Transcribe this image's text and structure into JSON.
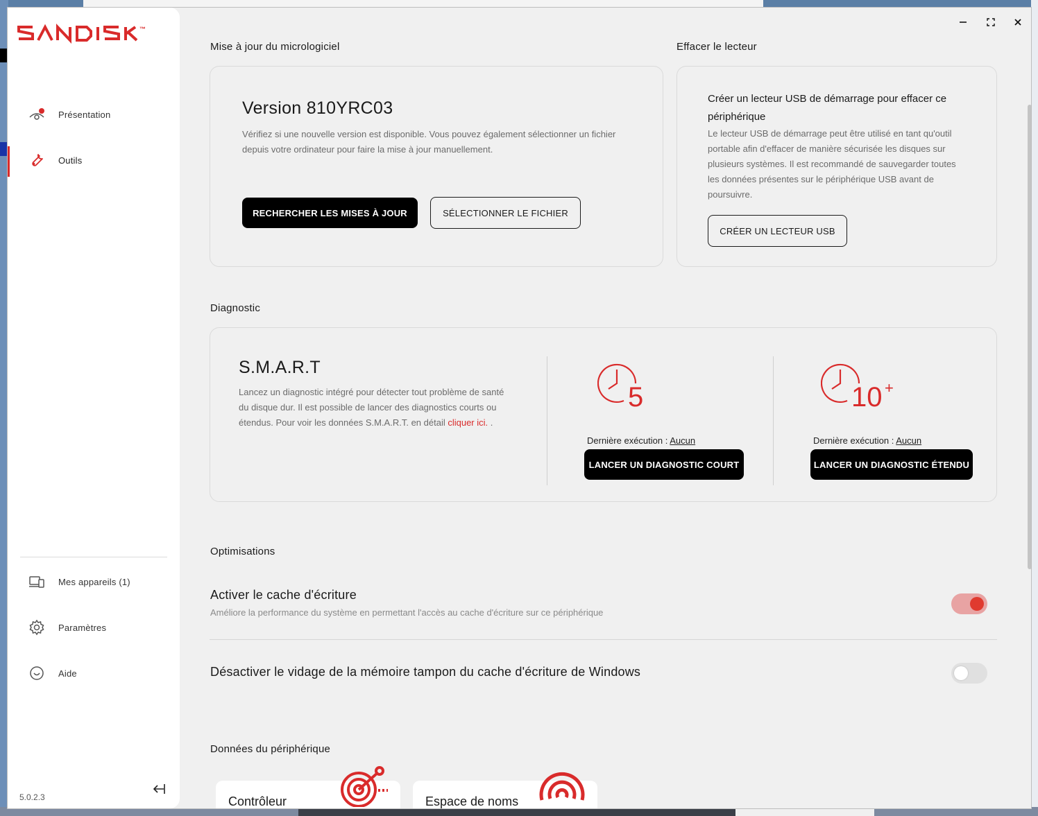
{
  "app": {
    "brand": "SANDISK",
    "trademark": "™",
    "version": "5.0.2.3",
    "accent_color": "#d92b2b"
  },
  "window_controls": {
    "minimize_icon": "minimize-icon",
    "maximize_icon": "maximize-icon",
    "close_icon": "close-icon"
  },
  "sidebar": {
    "items": [
      {
        "label": "Présentation",
        "icon": "eye-with-dot-icon"
      },
      {
        "label": "Outils",
        "icon": "wrench-icon",
        "active": true
      }
    ],
    "bottom_items": [
      {
        "label": "Mes appareils (1)",
        "icon": "devices-icon"
      },
      {
        "label": "Paramètres",
        "icon": "gear-icon"
      },
      {
        "label": "Aide",
        "icon": "help-icon"
      }
    ]
  },
  "firmware": {
    "section_title": "Mise à jour du micrologiciel",
    "version": "Version 810YRC03",
    "description": "Vérifiez si une nouvelle version est disponible. Vous pouvez également sélectionner un fichier depuis votre ordinateur pour faire la mise à jour manuellement.",
    "check_button": "RECHERCHER LES MISES À JOUR",
    "select_file_button": "SÉLECTIONNER LE FICHIER"
  },
  "erase": {
    "section_title": "Effacer le lecteur",
    "title": "Créer un lecteur USB de démarrage pour effacer ce périphérique",
    "description": "Le lecteur USB de démarrage peut être utilisé en tant qu'outil portable afin d'effacer de manière sécurisée les disques sur plusieurs systèmes. Il est recommandé de sauvegarder toutes les données présentes sur le périphérique USB avant de poursuivre.",
    "create_button": "CRÉER UN LECTEUR USB"
  },
  "diagnostic": {
    "section_title": "Diagnostic",
    "title": "S.M.A.R.T",
    "description": "Lancez un diagnostic intégré pour détecter tout problème de santé du disque dur. Il est possible de lancer des diagnostics courts ou étendus. Pour voir les données S.M.A.R.T. en détail",
    "link_text": "cliquer ici.",
    "link_suffix": " .",
    "short": {
      "icon_number": "5",
      "last_run_label": "Dernière exécution : ",
      "last_run_value": "Aucun",
      "button": "LANCER UN DIAGNOSTIC COURT"
    },
    "extended": {
      "icon_number": "10",
      "icon_plus": "+",
      "last_run_label": "Dernière exécution : ",
      "last_run_value": "Aucun",
      "button": "LANCER UN DIAGNOSTIC ÉTENDU"
    }
  },
  "optimisations": {
    "section_title": "Optimisations",
    "write_cache": {
      "title": "Activer le cache d'écriture",
      "description": "Améliore la performance du système en permettant l'accès au cache d'écriture sur ce périphérique",
      "enabled": true
    },
    "flush": {
      "title": "Désactiver le vidage de la mémoire tampon du cache d'écriture de Windows",
      "enabled": false
    }
  },
  "device_data": {
    "section_title": "Données du périphérique",
    "cards": [
      {
        "label": "Contrôleur",
        "icon": "radar-target-icon"
      },
      {
        "label": "Espace de noms",
        "icon": "signal-waves-icon"
      }
    ]
  }
}
